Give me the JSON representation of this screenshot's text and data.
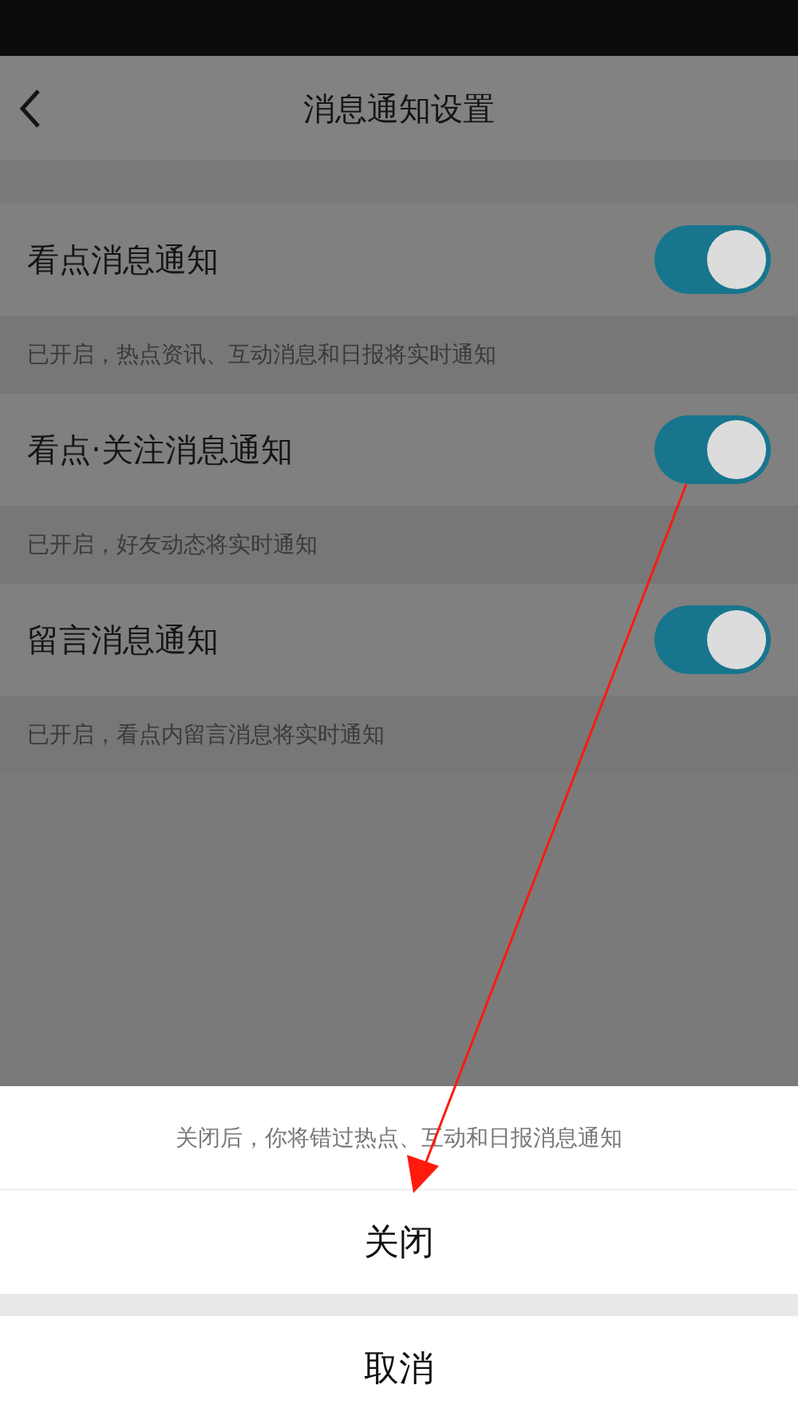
{
  "header": {
    "title": "消息通知设置"
  },
  "settings": [
    {
      "title": "看点消息通知",
      "on": true,
      "description": "已开启，热点资讯、互动消息和日报将实时通知"
    },
    {
      "title": "看点·关注消息通知",
      "on": true,
      "description": "已开启，好友动态将实时通知"
    },
    {
      "title": "留言消息通知",
      "on": true,
      "description": "已开启，看点内留言消息将实时通知"
    }
  ],
  "action_sheet": {
    "message": "关闭后，你将错过热点、互动和日报消息通知",
    "confirm_button": "关闭",
    "cancel_button": "取消"
  }
}
